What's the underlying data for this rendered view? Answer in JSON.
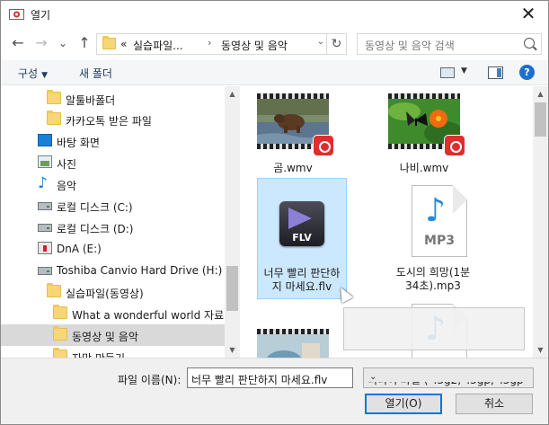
{
  "window": {
    "title": "열기",
    "close_glyph": "✕"
  },
  "nav": {
    "back": "←",
    "forward": "→",
    "recent": "⌄",
    "up": "↑",
    "address": {
      "overflow": "«",
      "crumbs": [
        "실습파일...",
        "동영상 및 음악"
      ],
      "separator": "›",
      "dropdown": "⌄",
      "refresh": "↻"
    },
    "search_placeholder": "동영상 및 음악 검색"
  },
  "toolbar": {
    "organize": "구성",
    "organize_caret": "▼",
    "new_folder": "새 폴더",
    "view_caret": "▼",
    "help": "?"
  },
  "sidebar": {
    "items": [
      {
        "label": "알툴바폴더",
        "icon": "folder-icon"
      },
      {
        "label": "카카오톡 받은 파일",
        "icon": "folder-icon"
      },
      {
        "label": "바탕 화면",
        "icon": "desktop-icon"
      },
      {
        "label": "사진",
        "icon": "pictures-icon"
      },
      {
        "label": "음악",
        "icon": "music-icon"
      },
      {
        "label": "로컬 디스크 (C:)",
        "icon": "drive-icon"
      },
      {
        "label": "로컬 디스크 (D:)",
        "icon": "drive-icon"
      },
      {
        "label": "DnA (E:)",
        "icon": "usb-drive-icon"
      },
      {
        "label": "Toshiba Canvio Hard Drive (H:)",
        "icon": "drive-icon"
      },
      {
        "label": "실습파일(동영상)",
        "icon": "folder-icon"
      },
      {
        "label": "What a wonderful world 자료",
        "icon": "folder-icon"
      },
      {
        "label": "동영상 및 음악",
        "icon": "folder-icon",
        "selected": true
      },
      {
        "label": "자막 만들기",
        "icon": "folder-icon"
      }
    ],
    "scroll_up": "▲",
    "scroll_down": "▼"
  },
  "files": {
    "items": [
      {
        "name": "곰.wmv",
        "type": "video"
      },
      {
        "name": "나비.wmv",
        "type": "video"
      },
      {
        "name_line1": "너무 빨리 판단하",
        "name_line2": "지 마세요.flv",
        "type": "flv",
        "selected": true,
        "icon_text": "FLV"
      },
      {
        "name_line1": "도시의 희망(1분",
        "name_line2": "34초).mp3",
        "type": "mp3",
        "icon_text": "MP3"
      },
      {
        "name": "",
        "type": "video"
      },
      {
        "name": "",
        "type": "mp3",
        "icon_text": ""
      }
    ],
    "scroll_up": "▲",
    "scroll_down": "▼"
  },
  "footer": {
    "filename_label": "파일 이름(N):",
    "filename_value": "너무 빨리 판단하지 마세요.flv",
    "filename_dropdown": "⌄",
    "filetype_value": "미디어 파일 (*.3g2;*.3gp;*.3gp",
    "filetype_dropdown": "⌄",
    "open_button": "열기(O)",
    "cancel_button": "취소"
  },
  "colors": {
    "selection": "#cce8ff",
    "sidebar_selected": "#d9d9d9",
    "accent": "#0078d7",
    "badge": "#e02d2d"
  }
}
